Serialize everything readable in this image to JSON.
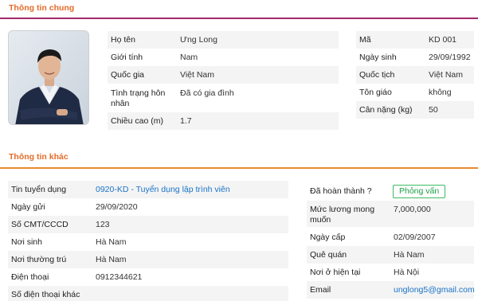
{
  "colors": {
    "accent": "#e36c2a",
    "general_rule": "#a3296b",
    "other_rule": "#e88a2e",
    "link": "#1a73c8",
    "badge": "#1ea04a"
  },
  "general": {
    "title": "Thông tin chung",
    "left": [
      {
        "label": "Họ tên",
        "value": "Ưng Long"
      },
      {
        "label": "Giới tính",
        "value": "Nam"
      },
      {
        "label": "Quốc gia",
        "value": "Việt Nam"
      },
      {
        "label": "Tình trạng hôn nhân",
        "value": "Đã có gia đình"
      },
      {
        "label": "Chiều cao (m)",
        "value": "1.7"
      }
    ],
    "right": [
      {
        "label": "Mã",
        "value": "KD 001"
      },
      {
        "label": "Ngày sinh",
        "value": "29/09/1992"
      },
      {
        "label": "Quốc tịch",
        "value": "Việt Nam"
      },
      {
        "label": "Tôn giáo",
        "value": "không"
      },
      {
        "label": "Cân nặng (kg)",
        "value": "50"
      }
    ]
  },
  "other": {
    "title": "Thông tin khác",
    "left": [
      {
        "label": "Tin tuyển dụng",
        "value": "0920-KD - Tuyển dụng lập trình viên"
      },
      {
        "label": "Ngày gửi",
        "value": "29/09/2020"
      },
      {
        "label": "Số CMT/CCCD",
        "value": "123"
      },
      {
        "label": "Nơi sinh",
        "value": "Hà Nam"
      },
      {
        "label": "Nơi thường trú",
        "value": "Hà Nam"
      },
      {
        "label": "Điện thoại",
        "value": "0912344621"
      },
      {
        "label": "Số điện thoại khác",
        "value": ""
      }
    ],
    "right": [
      {
        "label": "Đã hoàn thành ?",
        "badge": "Phỏng vấn"
      },
      {
        "label": "Mức lương mong muốn",
        "value": "7,000,000"
      },
      {
        "label": "Ngày cấp",
        "value": "02/09/2007"
      },
      {
        "label": "Quê quán",
        "value": "Hà Nam"
      },
      {
        "label": "Nơi ở hiện tại",
        "value": "Hà Nội"
      },
      {
        "label": "Email",
        "value": "unglong5@gmail.com"
      }
    ]
  },
  "avatar": {
    "icon": "person-photo"
  }
}
